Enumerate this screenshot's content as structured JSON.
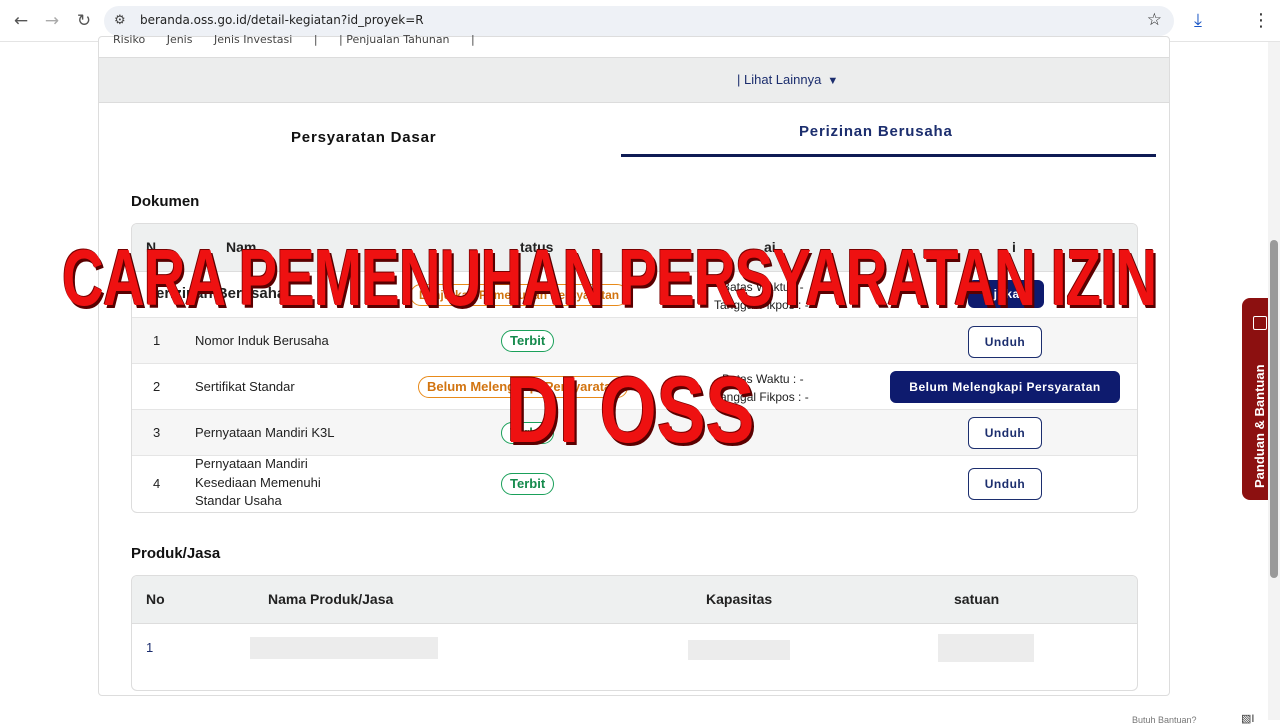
{
  "browser": {
    "url": "beranda.oss.go.id/detail-kegiatan?id_proyek=R",
    "back_icon": "arrow-left-icon",
    "forward_icon": "arrow-right-icon",
    "reload_icon": "reload-icon",
    "download_icon": "download-icon"
  },
  "top_partial": {
    "items": [
      "Risiko",
      "Jenis",
      "Jenis Investasi",
      "|",
      "| Penjualan Tahunan",
      "|"
    ]
  },
  "lihat_lainnya": "Lihat Lainnya",
  "tabs": [
    {
      "label": "Persyaratan Dasar",
      "active": false
    },
    {
      "label": "Perizinan Berusaha",
      "active": true
    }
  ],
  "dokumen": {
    "title": "Dokumen",
    "headers": [
      "No",
      "Nama Dokumen",
      "Status",
      "Keterangan",
      "Aksi"
    ],
    "header_partial": [
      "N",
      "Nam",
      "tatus",
      "ai",
      "i"
    ],
    "group_row": {
      "label": "Perizinan Berusaha",
      "status": "Lanjutkan Pemenuhan Persyaratan",
      "keterangan_1": "Batas Waktu : -",
      "keterangan_2": "Tanggal Fikpos : -",
      "action": "Ajukan"
    },
    "rows": [
      {
        "no": "1",
        "name": "Nomor Induk Berusaha",
        "status": "Terbit",
        "status_color": "green",
        "keterangan_1": "",
        "keterangan_2": "",
        "action": "Unduh"
      },
      {
        "no": "2",
        "name": "Sertifikat Standar",
        "status": "Belum Melengkapi Persyaratan",
        "status_color": "orange",
        "keterangan_1": "Batas Waktu : -",
        "keterangan_2": "Tanggal Fikpos : -",
        "action": "Belum Melengkapi Persyaratan"
      },
      {
        "no": "3",
        "name": "Pernyataan Mandiri K3L",
        "status": "Terbit",
        "status_color": "green",
        "keterangan_1": "",
        "keterangan_2": "",
        "action": "Unduh"
      },
      {
        "no": "4",
        "name_lines": [
          "Pernyataan Mandiri",
          "Kesediaan Memenuhi",
          "Standar Usaha"
        ],
        "status": "Terbit",
        "status_color": "green",
        "action": "Unduh"
      }
    ]
  },
  "produk": {
    "title": "Produk/Jasa",
    "headers": [
      "No",
      "Nama Produk/Jasa",
      "Kapasitas",
      "satuan"
    ],
    "rows": [
      {
        "no": "1"
      }
    ]
  },
  "overlay": {
    "line1": "CARA PEMENUHAN PERSYARATAN IZIN",
    "line2": "DI OSS"
  },
  "side_tab": {
    "label": "Panduan & Bantuan",
    "icon": "panel-icon"
  },
  "help": {
    "text": "Butuh Bantuan?",
    "img_alt": "I"
  },
  "colors": {
    "navy": "#0e1b6e",
    "green": "#148a4c",
    "orange": "#d27410",
    "overlay_red": "#ee1111",
    "side_tab": "#8c1010"
  }
}
